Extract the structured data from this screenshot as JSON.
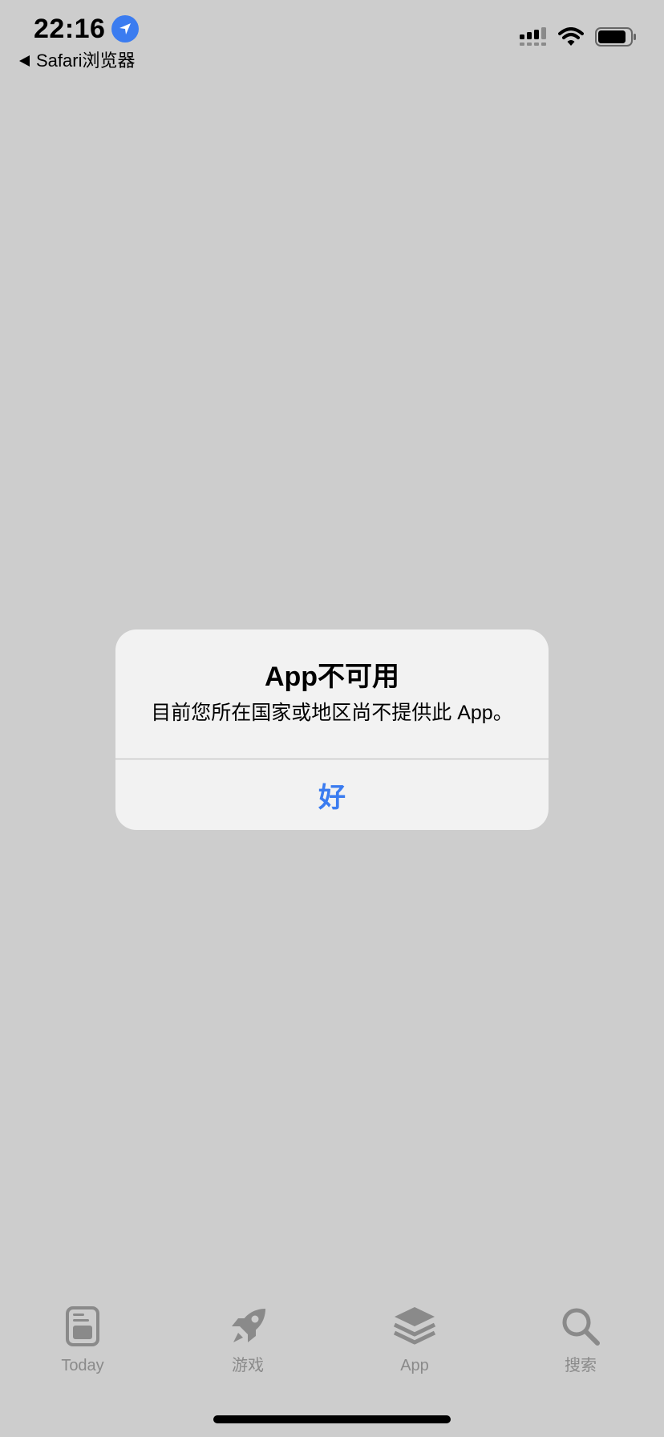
{
  "status_bar": {
    "time": "22:16",
    "back_label": "Safari浏览器",
    "icons": [
      "location-icon",
      "signal-icon",
      "wifi-icon",
      "battery-icon"
    ]
  },
  "alert": {
    "title": "App不可用",
    "message": "目前您所在国家或地区尚不提供此 App。",
    "button_label": "好"
  },
  "tab_bar": {
    "items": [
      {
        "label": "Today",
        "icon": "today-icon"
      },
      {
        "label": "游戏",
        "icon": "rocket-icon"
      },
      {
        "label": "App",
        "icon": "app-stack-icon"
      },
      {
        "label": "搜索",
        "icon": "search-icon"
      }
    ]
  },
  "colors": {
    "background": "#cdcdcd",
    "alert_background": "#f2f2f2",
    "accent": "#3b7cf0",
    "tab_inactive": "#8a8a8a"
  }
}
